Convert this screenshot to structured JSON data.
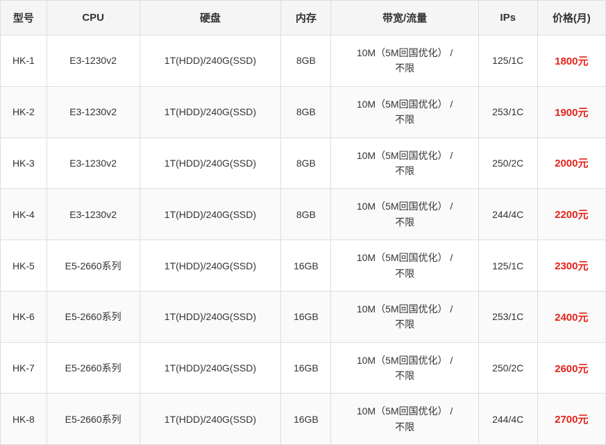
{
  "table": {
    "headers": [
      "型号",
      "CPU",
      "硬盘",
      "内存",
      "带宽/流量",
      "IPs",
      "价格(月)"
    ],
    "rows": [
      {
        "model": "HK-1",
        "cpu": "E3-1230v2",
        "disk": "1T(HDD)/240G(SSD)",
        "memory": "8GB",
        "bandwidth": "10M（5M回国优化）/不限",
        "ips": "125/1C",
        "price": "1800元"
      },
      {
        "model": "HK-2",
        "cpu": "E3-1230v2",
        "disk": "1T(HDD)/240G(SSD)",
        "memory": "8GB",
        "bandwidth": "10M（5M回国优化）/不限",
        "ips": "253/1C",
        "price": "1900元"
      },
      {
        "model": "HK-3",
        "cpu": "E3-1230v2",
        "disk": "1T(HDD)/240G(SSD)",
        "memory": "8GB",
        "bandwidth": "10M（5M回国优化）/不限",
        "ips": "250/2C",
        "price": "2000元"
      },
      {
        "model": "HK-4",
        "cpu": "E3-1230v2",
        "disk": "1T(HDD)/240G(SSD)",
        "memory": "8GB",
        "bandwidth": "10M（5M回国优化）/不限",
        "ips": "244/4C",
        "price": "2200元"
      },
      {
        "model": "HK-5",
        "cpu": "E5-2660系列",
        "disk": "1T(HDD)/240G(SSD)",
        "memory": "16GB",
        "bandwidth": "10M（5M回国优化）/不限",
        "ips": "125/1C",
        "price": "2300元"
      },
      {
        "model": "HK-6",
        "cpu": "E5-2660系列",
        "disk": "1T(HDD)/240G(SSD)",
        "memory": "16GB",
        "bandwidth": "10M（5M回国优化）/不限",
        "ips": "253/1C",
        "price": "2400元"
      },
      {
        "model": "HK-7",
        "cpu": "E5-2660系列",
        "disk": "1T(HDD)/240G(SSD)",
        "memory": "16GB",
        "bandwidth": "10M（5M回国优化）/不限",
        "ips": "250/2C",
        "price": "2600元"
      },
      {
        "model": "HK-8",
        "cpu": "E5-2660系列",
        "disk": "1T(HDD)/240G(SSD)",
        "memory": "16GB",
        "bandwidth": "10M（5M回国优化）/不限",
        "ips": "244/4C",
        "price": "2700元"
      }
    ]
  }
}
